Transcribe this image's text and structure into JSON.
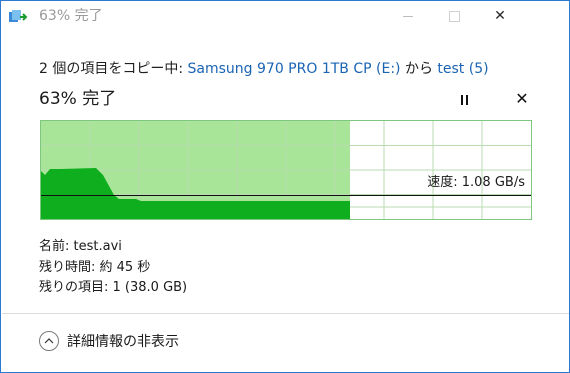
{
  "window": {
    "title": "63% 完了",
    "minimize_label": "–",
    "maximize_label": "☐",
    "close_label": "✕"
  },
  "copy": {
    "prefix": "2 個の項目をコピー中: ",
    "source": "Samsung 970 PRO 1TB CP (E:)",
    "middle": " から ",
    "destination": "test (5)"
  },
  "progress": {
    "heading": "63% 完了",
    "percent": 63,
    "speed_text": "速度: 1.08 GB/s",
    "pause_icon": "pause-icon",
    "cancel_label": "✕"
  },
  "details": {
    "name_line": "名前: test.avi",
    "time_line": "残り時間: 約 45 秒",
    "items_line": "残りの項目: 1 (38.0 GB)"
  },
  "footer": {
    "toggle_label": "詳細情報の非表示",
    "toggle_icon": "chevron-up-icon"
  },
  "colors": {
    "progress_fill": "#a8e598",
    "throughput": "#0fae1f",
    "link": "#1a64b4"
  }
}
